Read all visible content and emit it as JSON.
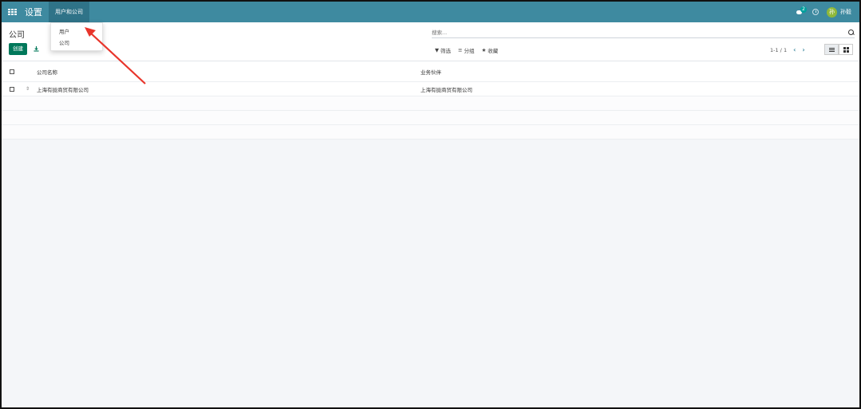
{
  "navbar": {
    "app_title": "设置",
    "active_menu": "用户和公司",
    "messages_badge": "2",
    "user_initial": "孙",
    "user_name": "孙毅"
  },
  "dropdown": {
    "items": [
      {
        "label": "用户"
      },
      {
        "label": "公司"
      }
    ]
  },
  "control_panel": {
    "breadcrumb": "公司",
    "create_label": "创建",
    "search_placeholder": "搜索...",
    "filter_label": "筛选",
    "groupby_label": "分组",
    "favorites_label": "收藏",
    "pager": "1-1 / 1"
  },
  "table": {
    "columns": [
      "公司名称",
      "业务伙伴"
    ],
    "rows": [
      {
        "name": "上海有拢商贸有限公司",
        "partner": "上海有拢商贸有限公司"
      }
    ]
  },
  "colors": {
    "navbar": "#3e8aa0",
    "primary_button": "#00785a",
    "annotation_arrow": "#e8352b"
  }
}
